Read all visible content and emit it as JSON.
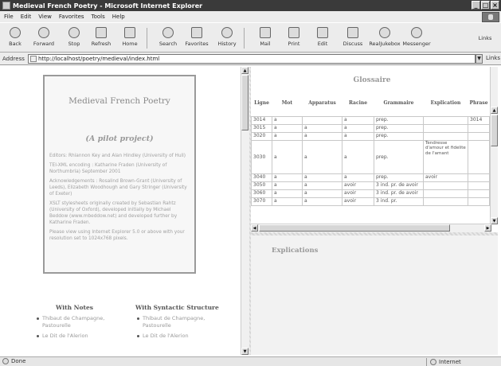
{
  "window": {
    "title": "Medieval French Poetry - Microsoft Internet Explorer",
    "min_label": "_",
    "max_label": "□",
    "close_label": "×"
  },
  "menu": [
    "File",
    "Edit",
    "View",
    "Favorites",
    "Tools",
    "Help"
  ],
  "toolbar": {
    "back": "Back",
    "forward": "Forward",
    "stop": "Stop",
    "refresh": "Refresh",
    "home": "Home",
    "search": "Search",
    "favorites": "Favorites",
    "history": "History",
    "mail": "Mail",
    "print": "Print",
    "edit": "Edit",
    "discuss": "Discuss",
    "realjukebox": "RealJukebox",
    "messenger": "Messenger",
    "links": "Links"
  },
  "address": {
    "label": "Address",
    "url": "http://localhost/poetry/medieval/index.html",
    "go": "Links"
  },
  "intro": {
    "title": "Medieval French Poetry",
    "subtitle": "(A pilot project)",
    "credits": [
      "Editors: Rhiannon Key and Alan Hindley (University of Hull)",
      "TEI-XML encoding : Katharine Fraden (University of Northumbria) September 2001",
      "Acknowledgements : Rosalind Brown-Grant (University of Leeds), Elizabeth Woodhough and Gary Stringer (University of Exeter)",
      "XSLT stylesheets originally created by Sebastian Rahtz (University of Oxford), developed initially by Michael Beddow (www.mbeddow.net) and developed further by Katharine Fraden.",
      "Please view using Internet Explorer 5.0 or above with your resolution set to 1024x768 pixels."
    ]
  },
  "sections": {
    "notes": {
      "heading": "With Notes",
      "items": [
        "Thibaut de Champagne, Pastourelle",
        "Le Dit de l'Alerion"
      ]
    },
    "syntax": {
      "heading": "With Syntactic Structure",
      "items": [
        "Thibaut de Champagne, Pastourelle",
        "Le Dit de l'Alerion"
      ]
    }
  },
  "glossary": {
    "title": "Glossaire",
    "headers": [
      "Ligne",
      "Mot",
      "Apparatus",
      "Racine",
      "Grammaire",
      "Explication",
      "Phrase"
    ],
    "rows": [
      [
        "3014",
        "a",
        "",
        "a",
        "prep.",
        "",
        "3014"
      ],
      [
        "3015",
        "a",
        "a",
        "a",
        "prep.",
        "",
        ""
      ],
      [
        "3020",
        "a",
        "a",
        "a",
        "prep.",
        "",
        ""
      ],
      [
        "3030",
        "a",
        "a",
        "a",
        "prep.",
        "Tendresse d'amour et fidelite de l'amant",
        ""
      ],
      [
        "3040",
        "a",
        "a",
        "a",
        "prep.",
        "avoir",
        ""
      ],
      [
        "3050",
        "a",
        "a",
        "avoir",
        "3 ind. pr. de avoir",
        "",
        ""
      ],
      [
        "3060",
        "a",
        "a",
        "avoir",
        "3 ind. pr. de avoir",
        "",
        ""
      ],
      [
        "3070",
        "a",
        "a",
        "avoir",
        "3 ind. pr.",
        "",
        ""
      ]
    ]
  },
  "explications": {
    "title": "Explications"
  },
  "status": {
    "text": "Done",
    "zone": "Internet"
  }
}
